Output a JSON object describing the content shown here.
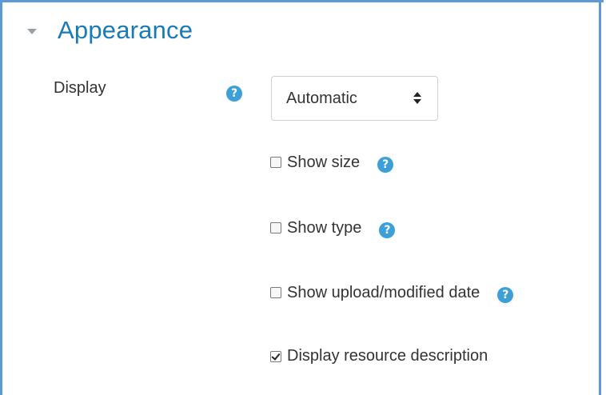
{
  "section": {
    "title": "Appearance",
    "toggle_icon": "caret-down-icon"
  },
  "display_field": {
    "label": "Display",
    "help_icon": "question-circle-icon",
    "help_glyph": "?",
    "select_value": "Automatic",
    "select_icon": "up-down-arrows-icon"
  },
  "options": [
    {
      "label": "Show size",
      "checked": false,
      "help_glyph": "?"
    },
    {
      "label": "Show type",
      "checked": false,
      "help_glyph": "?"
    },
    {
      "label": "Show upload/modified date",
      "checked": false,
      "help_glyph": "?"
    },
    {
      "label": "Display resource description",
      "checked": true
    }
  ],
  "colors": {
    "accent_border": "#5b9bd5",
    "title": "#1a7ab8",
    "help_icon": "#3d9fd8"
  }
}
